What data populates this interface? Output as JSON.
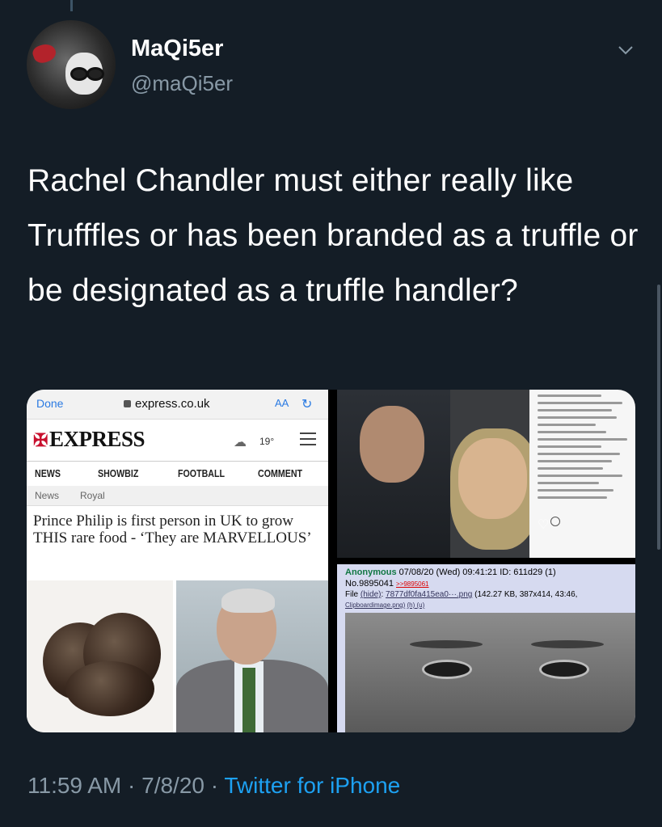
{
  "author": {
    "display_name": "MaQi5er",
    "handle": "@maQi5er"
  },
  "tweet": {
    "text": "Rachel Chandler must either really like Trufffles or has been branded as a truffle or be designated as a truffle handler?",
    "time": "11:59 AM",
    "sep1": " · ",
    "date": "7/8/20",
    "sep2": " · ",
    "source": "Twitter for iPhone"
  },
  "media": {
    "browser": {
      "done_label": "Done",
      "url": "express.co.uk",
      "aa_label": "AA",
      "reload_icon": "reload-icon"
    },
    "express": {
      "logo": "EXPRESS",
      "temperature": "19°",
      "nav_items": [
        "NEWS",
        "SHOWBIZ",
        "FOOTBALL",
        "COMMENT"
      ],
      "breadcrumbs": [
        "News",
        "Royal"
      ],
      "headline": "Prince Philip is first person in UK to grow THIS rare food - ‘They are MARVELLOUS’"
    },
    "post": {
      "name": "Anonymous",
      "datetime": "07/08/20 (Wed) 09:41:21",
      "id_label": "ID: 611d29",
      "id_count": "(1)",
      "number": "No.9895041",
      "reply_link": ">>9895061",
      "file_label": "File",
      "hide_link": "(hide)",
      "file_name": "7877df0fa415ea0···.png",
      "file_info": "(142.27 KB, 387x414, 43:46,",
      "original_name": "Clipboardimage.png)",
      "extra_links": "(h) (u)"
    }
  },
  "colors": {
    "background": "#141d26",
    "text": "#ffffff",
    "secondary": "#8899a6",
    "link": "#1da1f2"
  }
}
